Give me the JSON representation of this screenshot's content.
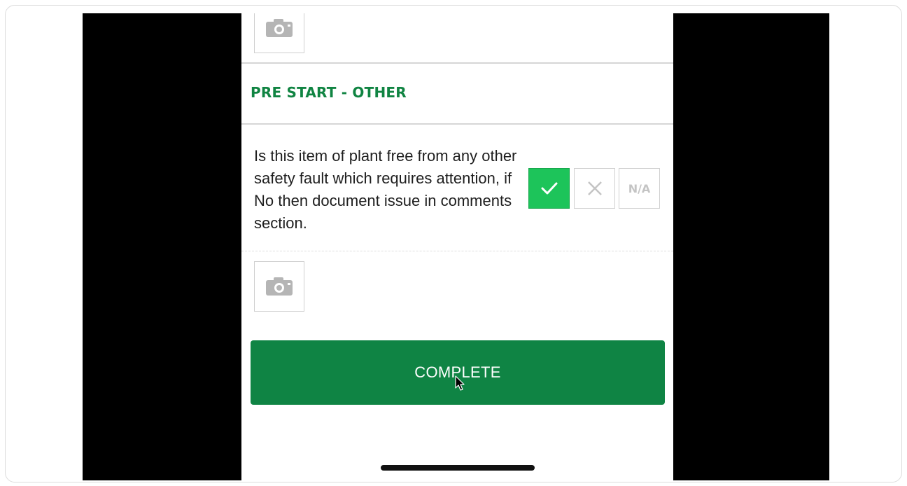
{
  "section": {
    "title": "PRE START - OTHER"
  },
  "question": {
    "text": "Is this item of plant free from any other safety fault which requires attention, if No then document issue in comments section.",
    "answers": {
      "yes_icon": "check-icon",
      "no_icon": "x-icon",
      "na_label": "N/A",
      "selected": "yes"
    }
  },
  "actions": {
    "complete_label": "COMPLETE"
  },
  "icons": {
    "photo": "camera-icon",
    "cursor": "mouse-cursor-icon"
  },
  "colors": {
    "accent": "#108442",
    "selected": "#1dc45a",
    "button": "#0f8444"
  }
}
